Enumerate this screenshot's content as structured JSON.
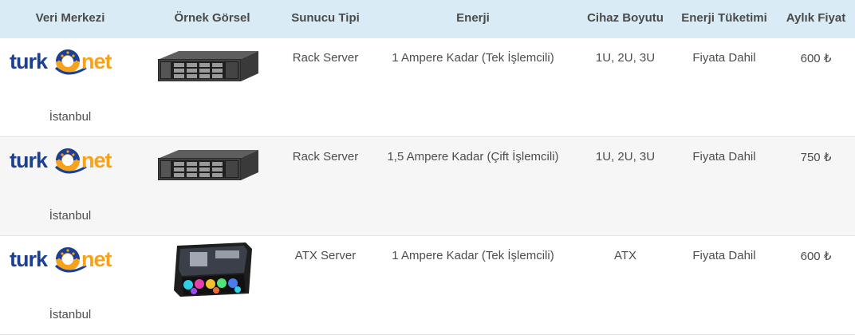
{
  "headers": {
    "data_center": "Veri Merkezi",
    "sample_image": "Örnek Görsel",
    "server_type": "Sunucu Tipi",
    "power": "Enerji",
    "device_size": "Cihaz Boyutu",
    "power_consumption": "Enerji Tüketimi",
    "monthly_price": "Aylık Fiyat"
  },
  "rows": [
    {
      "provider_logo": "turknet",
      "city": "İstanbul",
      "image_icon": "rack-server",
      "server_type": "Rack Server",
      "power": "1 Ampere Kadar (Tek İşlemcili)",
      "device_size": "1U, 2U, 3U",
      "power_consumption": "Fiyata Dahil",
      "monthly_price": "600 ₺"
    },
    {
      "provider_logo": "turknet",
      "city": "İstanbul",
      "image_icon": "rack-server",
      "server_type": "Rack Server",
      "power": "1,5 Ampere Kadar (Çift İşlemcili)",
      "device_size": "1U, 2U, 3U",
      "power_consumption": "Fiyata Dahil",
      "monthly_price": "750 ₺"
    },
    {
      "provider_logo": "turknet",
      "city": "İstanbul",
      "image_icon": "atx-case",
      "server_type": "ATX Server",
      "power": "1 Ampere Kadar (Tek İşlemcili)",
      "device_size": "ATX",
      "power_consumption": "Fiyata Dahil",
      "monthly_price": "600 ₺"
    }
  ],
  "colors": {
    "header_bg": "#d9ecf6",
    "logo_blue": "#1b3f93",
    "logo_orange": "#f7a21b",
    "text": "#4d4d4d"
  }
}
